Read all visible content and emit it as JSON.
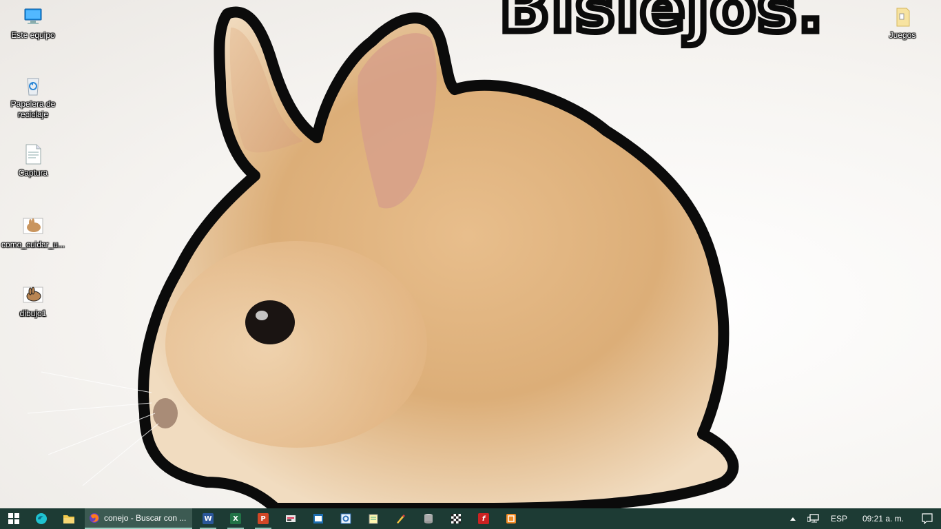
{
  "desktop": {
    "wallpaper_text": "Bisiejos.",
    "icons": [
      {
        "label": "Este equipo",
        "icon": "computer-icon"
      },
      {
        "label": "Papelera de reciclaje",
        "icon": "recycle-bin-icon"
      },
      {
        "label": "Captura",
        "icon": "document-icon"
      },
      {
        "label": "como_cuidar_u...",
        "icon": "rabbit-image-icon"
      },
      {
        "label": "dibujo1",
        "icon": "rabbit-image-icon"
      },
      {
        "label": "Juegos",
        "icon": "folder-icon"
      }
    ]
  },
  "taskbar": {
    "active_window": {
      "title": "conejo - Buscar con ...",
      "icon": "firefox-icon"
    },
    "pinned": [
      {
        "name": "start-button",
        "icon": "windows-logo-icon"
      },
      {
        "name": "edge",
        "icon": "edge-icon"
      },
      {
        "name": "file-explorer",
        "icon": "folder-icon"
      },
      {
        "name": "word",
        "icon": "word-icon",
        "letter": "W"
      },
      {
        "name": "excel",
        "icon": "excel-icon",
        "letter": "X"
      },
      {
        "name": "powerpoint",
        "icon": "powerpoint-icon",
        "letter": "P"
      },
      {
        "name": "settings-tool",
        "icon": "tool-icon"
      },
      {
        "name": "publisher",
        "icon": "publisher-icon"
      },
      {
        "name": "outlook",
        "icon": "outlook-icon"
      },
      {
        "name": "notepad",
        "icon": "notepad-icon"
      },
      {
        "name": "paint",
        "icon": "paint-icon"
      },
      {
        "name": "database",
        "icon": "database-icon"
      },
      {
        "name": "chess",
        "icon": "chess-icon"
      },
      {
        "name": "flash",
        "icon": "flash-icon",
        "letter": "f"
      },
      {
        "name": "app-orange",
        "icon": "app-icon"
      }
    ],
    "tray": {
      "language": "ESP",
      "time": "09:21 a. m.",
      "chevron": "^"
    }
  },
  "colors": {
    "taskbar_bg": "#1d3b34",
    "active_button_bg": "#3c5a52",
    "word": "#2b579a",
    "excel": "#217346",
    "powerpoint": "#d24726",
    "flash": "#cc2222"
  }
}
